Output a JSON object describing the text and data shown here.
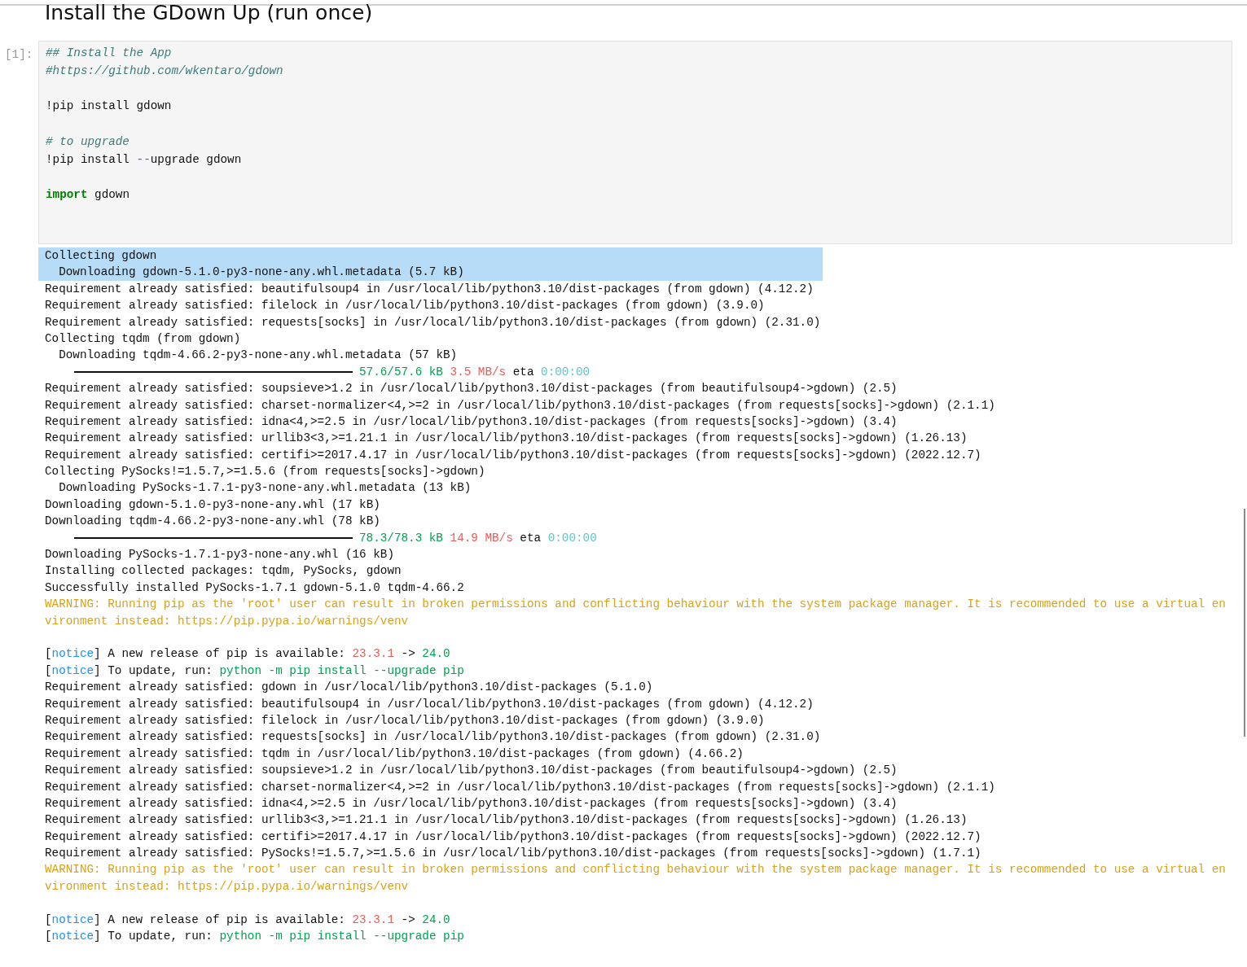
{
  "heading": "Install the GDown Up (run once)",
  "cell": {
    "prompt": "[1]:",
    "code": [
      {
        "kind": "code",
        "segments": [
          {
            "text": "## Install the App",
            "kind": "comment"
          }
        ]
      },
      {
        "kind": "code",
        "segments": [
          {
            "text": "#https://github.com/wkentaro/gdown",
            "kind": "comment"
          }
        ]
      },
      {
        "kind": "blank"
      },
      {
        "kind": "code",
        "segments": [
          {
            "text": "!pip install gdown",
            "kind": "plain"
          }
        ]
      },
      {
        "kind": "blank"
      },
      {
        "kind": "code",
        "segments": [
          {
            "text": "# to upgrade",
            "kind": "comment"
          }
        ]
      },
      {
        "kind": "code",
        "segments": [
          {
            "text": "!pip install ",
            "kind": "plain"
          },
          {
            "text": "--",
            "kind": "operator"
          },
          {
            "text": "upgrade gdown",
            "kind": "plain"
          }
        ]
      },
      {
        "kind": "blank"
      },
      {
        "kind": "code",
        "segments": [
          {
            "text": "import",
            "kind": "keyword"
          },
          {
            "text": " gdown",
            "kind": "plain"
          }
        ]
      },
      {
        "kind": "blank"
      },
      {
        "kind": "blank"
      }
    ],
    "output": [
      {
        "kind": "text",
        "selected": true,
        "text": "Collecting gdown"
      },
      {
        "kind": "text",
        "selected": true,
        "text": "  Downloading gdown-5.1.0-py3-none-any.whl.metadata (5.7 kB)"
      },
      {
        "kind": "text",
        "selected": false,
        "text": "Requirement already satisfied: beautifulsoup4 in /usr/local/lib/python3.10/dist-packages (from gdown) (4.12.2)"
      },
      {
        "kind": "text",
        "selected": false,
        "text": "Requirement already satisfied: filelock in /usr/local/lib/python3.10/dist-packages (from gdown) (3.9.0)"
      },
      {
        "kind": "text",
        "selected": false,
        "text": "Requirement already satisfied: requests[socks] in /usr/local/lib/python3.10/dist-packages (from gdown) (2.31.0)"
      },
      {
        "kind": "text",
        "selected": false,
        "text": "Collecting tqdm (from gdown)"
      },
      {
        "kind": "text",
        "selected": false,
        "text": "  Downloading tqdm-4.66.2-py3-none-any.whl.metadata (57 kB)"
      },
      {
        "kind": "progress",
        "selected": false,
        "level": 1,
        "segments": [
          {
            "text": "57.6/57.6 kB",
            "kind": "size"
          },
          {
            "text": "3.5 MB/s",
            "kind": "rate"
          },
          {
            "text": " eta ",
            "kind": "plain"
          },
          {
            "text": "0:00:00",
            "kind": "eta"
          }
        ]
      },
      {
        "kind": "text",
        "selected": false,
        "text": "Requirement already satisfied: soupsieve>1.2 in /usr/local/lib/python3.10/dist-packages (from beautifulsoup4->gdown) (2.5)"
      },
      {
        "kind": "text",
        "selected": false,
        "text": "Requirement already satisfied: charset-normalizer<4,>=2 in /usr/local/lib/python3.10/dist-packages (from requests[socks]->gdown) (2.1.1)"
      },
      {
        "kind": "text",
        "selected": false,
        "text": "Requirement already satisfied: idna<4,>=2.5 in /usr/local/lib/python3.10/dist-packages (from requests[socks]->gdown) (3.4)"
      },
      {
        "kind": "text",
        "selected": false,
        "text": "Requirement already satisfied: urllib3<3,>=1.21.1 in /usr/local/lib/python3.10/dist-packages (from requests[socks]->gdown) (1.26.13)"
      },
      {
        "kind": "text",
        "selected": false,
        "text": "Requirement already satisfied: certifi>=2017.4.17 in /usr/local/lib/python3.10/dist-packages (from requests[socks]->gdown) (2022.12.7)"
      },
      {
        "kind": "text",
        "selected": false,
        "text": "Collecting PySocks!=1.5.7,>=1.5.6 (from requests[socks]->gdown)"
      },
      {
        "kind": "text",
        "selected": false,
        "text": "  Downloading PySocks-1.7.1-py3-none-any.whl.metadata (13 kB)"
      },
      {
        "kind": "text",
        "selected": false,
        "text": "Downloading gdown-5.1.0-py3-none-any.whl (17 kB)"
      },
      {
        "kind": "text",
        "selected": false,
        "text": "Downloading tqdm-4.66.2-py3-none-any.whl (78 kB)"
      },
      {
        "kind": "progress",
        "selected": false,
        "level": 1,
        "segments": [
          {
            "text": "78.3/78.3 kB",
            "kind": "size"
          },
          {
            "text": "14.9 MB/s",
            "kind": "rate"
          },
          {
            "text": " eta ",
            "kind": "plain"
          },
          {
            "text": "0:00:00",
            "kind": "eta"
          }
        ]
      },
      {
        "kind": "text",
        "selected": false,
        "text": "Downloading PySocks-1.7.1-py3-none-any.whl (16 kB)"
      },
      {
        "kind": "text",
        "selected": false,
        "text": "Installing collected packages: tqdm, PySocks, gdown"
      },
      {
        "kind": "text",
        "selected": false,
        "text": "Successfully installed PySocks-1.7.1 gdown-5.1.0 tqdm-4.66.2"
      },
      {
        "kind": "text",
        "selected": false,
        "segments": [
          {
            "text": "WARNING: Running pip as the 'root' user can result in broken permissions and conflicting behaviour with the system package manager. It is recommended to use a virtual en",
            "kind": "warning"
          }
        ]
      },
      {
        "kind": "text",
        "selected": false,
        "segments": [
          {
            "text": "vironment instead: https://pip.pypa.io/warnings/venv",
            "kind": "warning"
          }
        ]
      },
      {
        "kind": "blank",
        "selected": false
      },
      {
        "kind": "text",
        "selected": false,
        "segments": [
          {
            "text": "[",
            "kind": "plain"
          },
          {
            "text": "notice",
            "kind": "notice"
          },
          {
            "text": "] A new release of pip is available: ",
            "kind": "plain"
          },
          {
            "text": "23.3.1",
            "kind": "old"
          },
          {
            "text": " -> ",
            "kind": "plain"
          },
          {
            "text": "24.0",
            "kind": "new"
          }
        ]
      },
      {
        "kind": "text",
        "selected": false,
        "segments": [
          {
            "text": "[",
            "kind": "plain"
          },
          {
            "text": "notice",
            "kind": "notice"
          },
          {
            "text": "] To update, run: ",
            "kind": "plain"
          },
          {
            "text": "python -m pip install --upgrade pip",
            "kind": "command"
          }
        ]
      },
      {
        "kind": "text",
        "selected": false,
        "text": "Requirement already satisfied: gdown in /usr/local/lib/python3.10/dist-packages (5.1.0)"
      },
      {
        "kind": "text",
        "selected": false,
        "text": "Requirement already satisfied: beautifulsoup4 in /usr/local/lib/python3.10/dist-packages (from gdown) (4.12.2)"
      },
      {
        "kind": "text",
        "selected": false,
        "text": "Requirement already satisfied: filelock in /usr/local/lib/python3.10/dist-packages (from gdown) (3.9.0)"
      },
      {
        "kind": "text",
        "selected": false,
        "text": "Requirement already satisfied: requests[socks] in /usr/local/lib/python3.10/dist-packages (from gdown) (2.31.0)"
      },
      {
        "kind": "text",
        "selected": false,
        "text": "Requirement already satisfied: tqdm in /usr/local/lib/python3.10/dist-packages (from gdown) (4.66.2)"
      },
      {
        "kind": "text",
        "selected": false,
        "text": "Requirement already satisfied: soupsieve>1.2 in /usr/local/lib/python3.10/dist-packages (from beautifulsoup4->gdown) (2.5)"
      },
      {
        "kind": "text",
        "selected": false,
        "text": "Requirement already satisfied: charset-normalizer<4,>=2 in /usr/local/lib/python3.10/dist-packages (from requests[socks]->gdown) (2.1.1)"
      },
      {
        "kind": "text",
        "selected": false,
        "text": "Requirement already satisfied: idna<4,>=2.5 in /usr/local/lib/python3.10/dist-packages (from requests[socks]->gdown) (3.4)"
      },
      {
        "kind": "text",
        "selected": false,
        "text": "Requirement already satisfied: urllib3<3,>=1.21.1 in /usr/local/lib/python3.10/dist-packages (from requests[socks]->gdown) (1.26.13)"
      },
      {
        "kind": "text",
        "selected": false,
        "text": "Requirement already satisfied: certifi>=2017.4.17 in /usr/local/lib/python3.10/dist-packages (from requests[socks]->gdown) (2022.12.7)"
      },
      {
        "kind": "text",
        "selected": false,
        "text": "Requirement already satisfied: PySocks!=1.5.7,>=1.5.6 in /usr/local/lib/python3.10/dist-packages (from requests[socks]->gdown) (1.7.1)"
      },
      {
        "kind": "text",
        "selected": false,
        "segments": [
          {
            "text": "WARNING: Running pip as the 'root' user can result in broken permissions and conflicting behaviour with the system package manager. It is recommended to use a virtual en",
            "kind": "warning"
          }
        ]
      },
      {
        "kind": "text",
        "selected": false,
        "segments": [
          {
            "text": "vironment instead: https://pip.pypa.io/warnings/venv",
            "kind": "warning"
          }
        ]
      },
      {
        "kind": "blank",
        "selected": false
      },
      {
        "kind": "text",
        "selected": false,
        "segments": [
          {
            "text": "[",
            "kind": "plain"
          },
          {
            "text": "notice",
            "kind": "notice"
          },
          {
            "text": "] A new release of pip is available: ",
            "kind": "plain"
          },
          {
            "text": "23.3.1",
            "kind": "old"
          },
          {
            "text": " -> ",
            "kind": "plain"
          },
          {
            "text": "24.0",
            "kind": "new"
          }
        ]
      },
      {
        "kind": "text",
        "selected": false,
        "segments": [
          {
            "text": "[",
            "kind": "plain"
          },
          {
            "text": "notice",
            "kind": "notice"
          },
          {
            "text": "] To update, run: ",
            "kind": "plain"
          },
          {
            "text": "python -m pip install --upgrade pip",
            "kind": "command"
          }
        ]
      }
    ]
  }
}
